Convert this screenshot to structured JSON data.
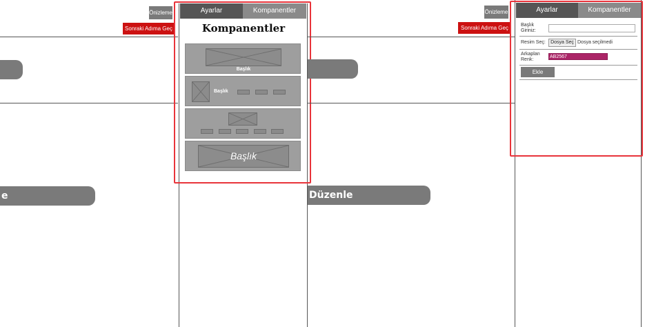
{
  "toolbar_left": {
    "preview_label": "Önizleme",
    "next_label": "Sonraki Adıma Geç"
  },
  "toolbar_right": {
    "preview_label": "Önizleme",
    "next_label": "Sonraki Adıma Geç"
  },
  "canvas_left": {
    "bar_bottom_label": "e"
  },
  "canvas_right": {
    "bar_bottom_label": "Düzenle"
  },
  "panel_left": {
    "tabs": [
      {
        "label": "Ayarlar"
      },
      {
        "label": "Kompanentler"
      }
    ],
    "title": "Kompanentler",
    "cards": [
      {
        "label": "Başlık"
      },
      {
        "label": "Başlık",
        "buttons": [
          "Button",
          "Button",
          "Button"
        ]
      },
      {
        "buttons": [
          "Button",
          "Button",
          "Button",
          "Button",
          "Button"
        ]
      },
      {
        "label": "Başlık"
      }
    ]
  },
  "panel_right": {
    "tabs": [
      {
        "label": "Ayarlar"
      },
      {
        "label": "Kompanentler"
      }
    ],
    "form": {
      "title_label": "Başlık Giriniz:",
      "title_value": "",
      "image_label": "Resim Seç:",
      "file_button": "Dosya Seç",
      "file_status": "Dosya seçilmedi",
      "bg_label": "Arkaplan Renk:",
      "bg_value": "AB2567",
      "bg_color": "#ab2567",
      "add_button": "Ekle"
    }
  },
  "colors": {
    "highlight": "#e8333a",
    "tab_dark": "#555555",
    "tab_light": "#8a8a8a",
    "next_button": "#cc1111"
  }
}
